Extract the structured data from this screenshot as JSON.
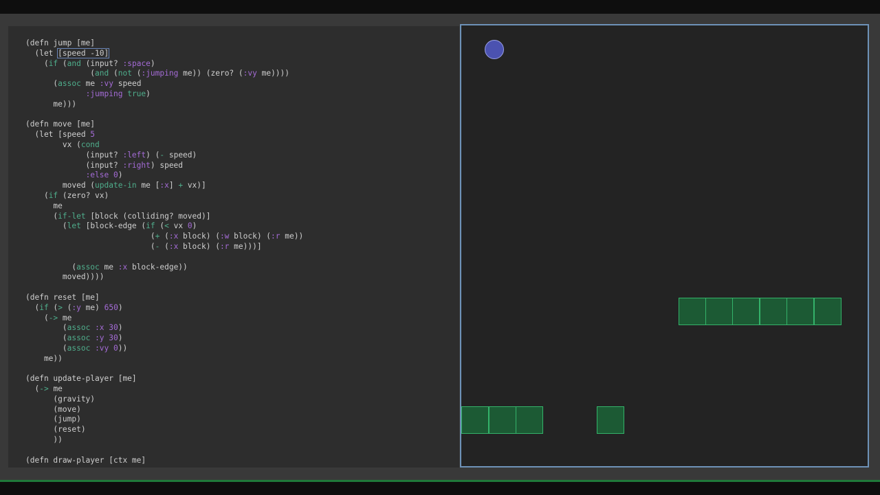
{
  "editor": {
    "language": "clojure",
    "lines": [
      [
        [
          "p",
          "(defn jump [me]"
        ]
      ],
      [
        [
          "p",
          "  (let "
        ],
        [
          "c",
          "[speed -10]"
        ]
      ],
      [
        [
          "p",
          "    ("
        ],
        [
          "k",
          "if"
        ],
        [
          "p",
          " ("
        ],
        [
          "k",
          "and"
        ],
        [
          "p",
          " (input? "
        ],
        [
          "w",
          ":space"
        ],
        [
          "p",
          ")"
        ]
      ],
      [
        [
          "p",
          "              ("
        ],
        [
          "k",
          "and"
        ],
        [
          "p",
          " ("
        ],
        [
          "k",
          "not"
        ],
        [
          "p",
          " ("
        ],
        [
          "w",
          ":jumping"
        ],
        [
          "p",
          " me)) (zero? ("
        ],
        [
          "w",
          ":vy"
        ],
        [
          "p",
          " me))))"
        ]
      ],
      [
        [
          "p",
          "      ("
        ],
        [
          "k",
          "assoc"
        ],
        [
          "p",
          " me "
        ],
        [
          "w",
          ":vy"
        ],
        [
          "p",
          " speed"
        ]
      ],
      [
        [
          "p",
          "             "
        ],
        [
          "w",
          ":jumping"
        ],
        [
          "p",
          " "
        ],
        [
          "k",
          "true"
        ],
        [
          "p",
          ")"
        ]
      ],
      [
        [
          "p",
          "      me)))"
        ]
      ],
      [
        [
          "p",
          ""
        ]
      ],
      [
        [
          "p",
          "(defn move [me]"
        ]
      ],
      [
        [
          "p",
          "  (let [speed "
        ],
        [
          "n",
          "5"
        ]
      ],
      [
        [
          "p",
          "        vx ("
        ],
        [
          "k",
          "cond"
        ]
      ],
      [
        [
          "p",
          "             (input? "
        ],
        [
          "w",
          ":left"
        ],
        [
          "p",
          ") ("
        ],
        [
          "k",
          "-"
        ],
        [
          "p",
          " speed)"
        ]
      ],
      [
        [
          "p",
          "             (input? "
        ],
        [
          "w",
          ":right"
        ],
        [
          "p",
          ") speed"
        ]
      ],
      [
        [
          "p",
          "             "
        ],
        [
          "w",
          ":else"
        ],
        [
          "p",
          " "
        ],
        [
          "n",
          "0"
        ],
        [
          "p",
          ")"
        ]
      ],
      [
        [
          "p",
          "        moved ("
        ],
        [
          "k",
          "update-in"
        ],
        [
          "p",
          " me ["
        ],
        [
          "w",
          ":x"
        ],
        [
          "p",
          "] "
        ],
        [
          "k",
          "+"
        ],
        [
          "p",
          " vx)]"
        ]
      ],
      [
        [
          "p",
          "    ("
        ],
        [
          "k",
          "if"
        ],
        [
          "p",
          " (zero? vx)"
        ]
      ],
      [
        [
          "p",
          "      me"
        ]
      ],
      [
        [
          "p",
          "      ("
        ],
        [
          "k",
          "if-let"
        ],
        [
          "p",
          " [block (colliding? moved)]"
        ]
      ],
      [
        [
          "p",
          "        ("
        ],
        [
          "k",
          "let"
        ],
        [
          "p",
          " [block-edge ("
        ],
        [
          "k",
          "if"
        ],
        [
          "p",
          " ("
        ],
        [
          "k",
          "<"
        ],
        [
          "p",
          " vx "
        ],
        [
          "n",
          "0"
        ],
        [
          "p",
          ")"
        ]
      ],
      [
        [
          "p",
          "                           ("
        ],
        [
          "k",
          "+"
        ],
        [
          "p",
          " ("
        ],
        [
          "w",
          ":x"
        ],
        [
          "p",
          " block) ("
        ],
        [
          "w",
          ":w"
        ],
        [
          "p",
          " block) ("
        ],
        [
          "w",
          ":r"
        ],
        [
          "p",
          " me))"
        ]
      ],
      [
        [
          "p",
          "                           ("
        ],
        [
          "k",
          "-"
        ],
        [
          "p",
          " ("
        ],
        [
          "w",
          ":x"
        ],
        [
          "p",
          " block) ("
        ],
        [
          "w",
          ":r"
        ],
        [
          "p",
          " me)))]"
        ]
      ],
      [
        [
          "p",
          ""
        ]
      ],
      [
        [
          "p",
          "          ("
        ],
        [
          "k",
          "assoc"
        ],
        [
          "p",
          " me "
        ],
        [
          "w",
          ":x"
        ],
        [
          "p",
          " block-edge))"
        ]
      ],
      [
        [
          "p",
          "        moved))))"
        ]
      ],
      [
        [
          "p",
          ""
        ]
      ],
      [
        [
          "p",
          "(defn reset [me]"
        ]
      ],
      [
        [
          "p",
          "  ("
        ],
        [
          "k",
          "if"
        ],
        [
          "p",
          " ("
        ],
        [
          "k",
          ">"
        ],
        [
          "p",
          " ("
        ],
        [
          "w",
          ":y"
        ],
        [
          "p",
          " me) "
        ],
        [
          "n",
          "650"
        ],
        [
          "p",
          ")"
        ]
      ],
      [
        [
          "p",
          "    ("
        ],
        [
          "k",
          "->"
        ],
        [
          "p",
          " me"
        ]
      ],
      [
        [
          "p",
          "        ("
        ],
        [
          "k",
          "assoc"
        ],
        [
          "p",
          " "
        ],
        [
          "w",
          ":x"
        ],
        [
          "p",
          " "
        ],
        [
          "n",
          "30"
        ],
        [
          "p",
          ")"
        ]
      ],
      [
        [
          "p",
          "        ("
        ],
        [
          "k",
          "assoc"
        ],
        [
          "p",
          " "
        ],
        [
          "w",
          ":y"
        ],
        [
          "p",
          " "
        ],
        [
          "n",
          "30"
        ],
        [
          "p",
          ")"
        ]
      ],
      [
        [
          "p",
          "        ("
        ],
        [
          "k",
          "assoc"
        ],
        [
          "p",
          " "
        ],
        [
          "w",
          ":vy"
        ],
        [
          "p",
          " "
        ],
        [
          "n",
          "0"
        ],
        [
          "p",
          "))"
        ]
      ],
      [
        [
          "p",
          "    me))"
        ]
      ],
      [
        [
          "p",
          ""
        ]
      ],
      [
        [
          "p",
          "(defn update-player [me]"
        ]
      ],
      [
        [
          "p",
          "  ("
        ],
        [
          "k",
          "->"
        ],
        [
          "p",
          " me"
        ]
      ],
      [
        [
          "p",
          "      (gravity)"
        ]
      ],
      [
        [
          "p",
          "      (move)"
        ]
      ],
      [
        [
          "p",
          "      (jump)"
        ]
      ],
      [
        [
          "p",
          "      (reset)"
        ]
      ],
      [
        [
          "p",
          "      ))"
        ]
      ],
      [
        [
          "p",
          ""
        ]
      ],
      [
        [
          "p",
          "(defn draw-player [ctx me]"
        ]
      ]
    ]
  },
  "game": {
    "player_color": "#4b52b0",
    "block_color": "#1c5a34",
    "block_border_color": "#34b36a",
    "border_color": "#6e92b8"
  }
}
